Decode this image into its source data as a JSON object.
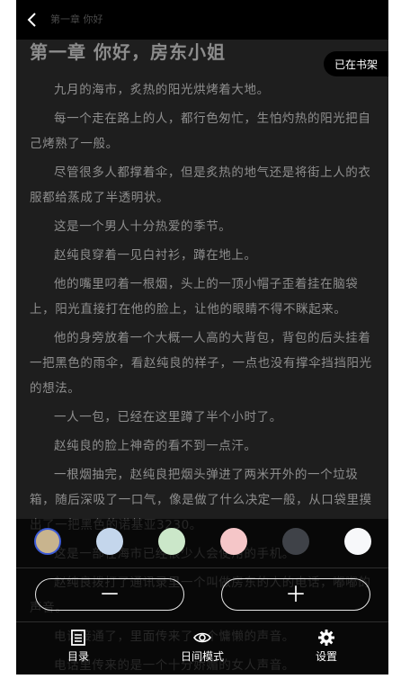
{
  "header": {
    "back_icon": "chevron-left-icon",
    "title": "第一章 你好"
  },
  "chapter": {
    "title": "第一章 你好，房东小姐",
    "shelf_badge": "已在书架",
    "paragraphs": [
      "九月的海市，炙热的阳光烘烤着大地。",
      "每一个走在路上的人，都行色匆忙，生怕灼热的阳光把自己烤熟了一般。",
      "尽管很多人都撑着伞，但是炙热的地气还是将街上人的衣服都给蒸成了半透明状。",
      "这是一个男人十分热爱的季节。",
      "赵纯良穿着一见白衬衫，蹲在地上。",
      "他的嘴里叼着一根烟，头上的一顶小帽子歪着挂在脑袋上，阳光直接打在他的脸上，让他的眼睛不得不眯起来。",
      "他的身旁放着一个大概一人高的大背包，背包的后头挂着一把黑色的雨伞，看赵纯良的样子，一点也没有撑伞挡挡阳光的想法。",
      "一人一包，已经在这里蹲了半个小时了。",
      "赵纯良的脸上神奇的看不到一点汗。",
      "一根烟抽完，赵纯良把烟头弹进了两米开外的一个垃圾箱，随后深吸了一口气，像是做了什么决定一般，从口袋里摸出了一把黑色的诺基亚3230。",
      "这是一部在海市已经很少人会使用的手机。",
      "赵纯良拨打了通讯录里一个叫做房东的人的电话，嘟嘟的声音。",
      "电话接通了，里面传来了一个慵懒的声音。",
      "电话里传来的是一个十分娇媚的女人声音。"
    ]
  },
  "settings_panel": {
    "background_swatches": [
      {
        "name": "tan",
        "color": "#c8b48e",
        "selected": true
      },
      {
        "name": "light-blue",
        "color": "#c4d6ec",
        "selected": false
      },
      {
        "name": "light-green",
        "color": "#cbe7c9",
        "selected": false
      },
      {
        "name": "pink",
        "color": "#f5c6c8",
        "selected": false
      },
      {
        "name": "dark-gray",
        "color": "#3f4248",
        "selected": false
      },
      {
        "name": "white",
        "color": "#f7f8fa",
        "selected": false
      }
    ],
    "font_decrease_label": "－",
    "font_increase_label": "＋"
  },
  "bottom_nav": {
    "toc": {
      "label": "目录",
      "icon": "list-icon"
    },
    "day_mode": {
      "label": "日间模式",
      "icon": "eye-icon"
    },
    "settings": {
      "label": "设置",
      "icon": "gear-icon"
    }
  }
}
